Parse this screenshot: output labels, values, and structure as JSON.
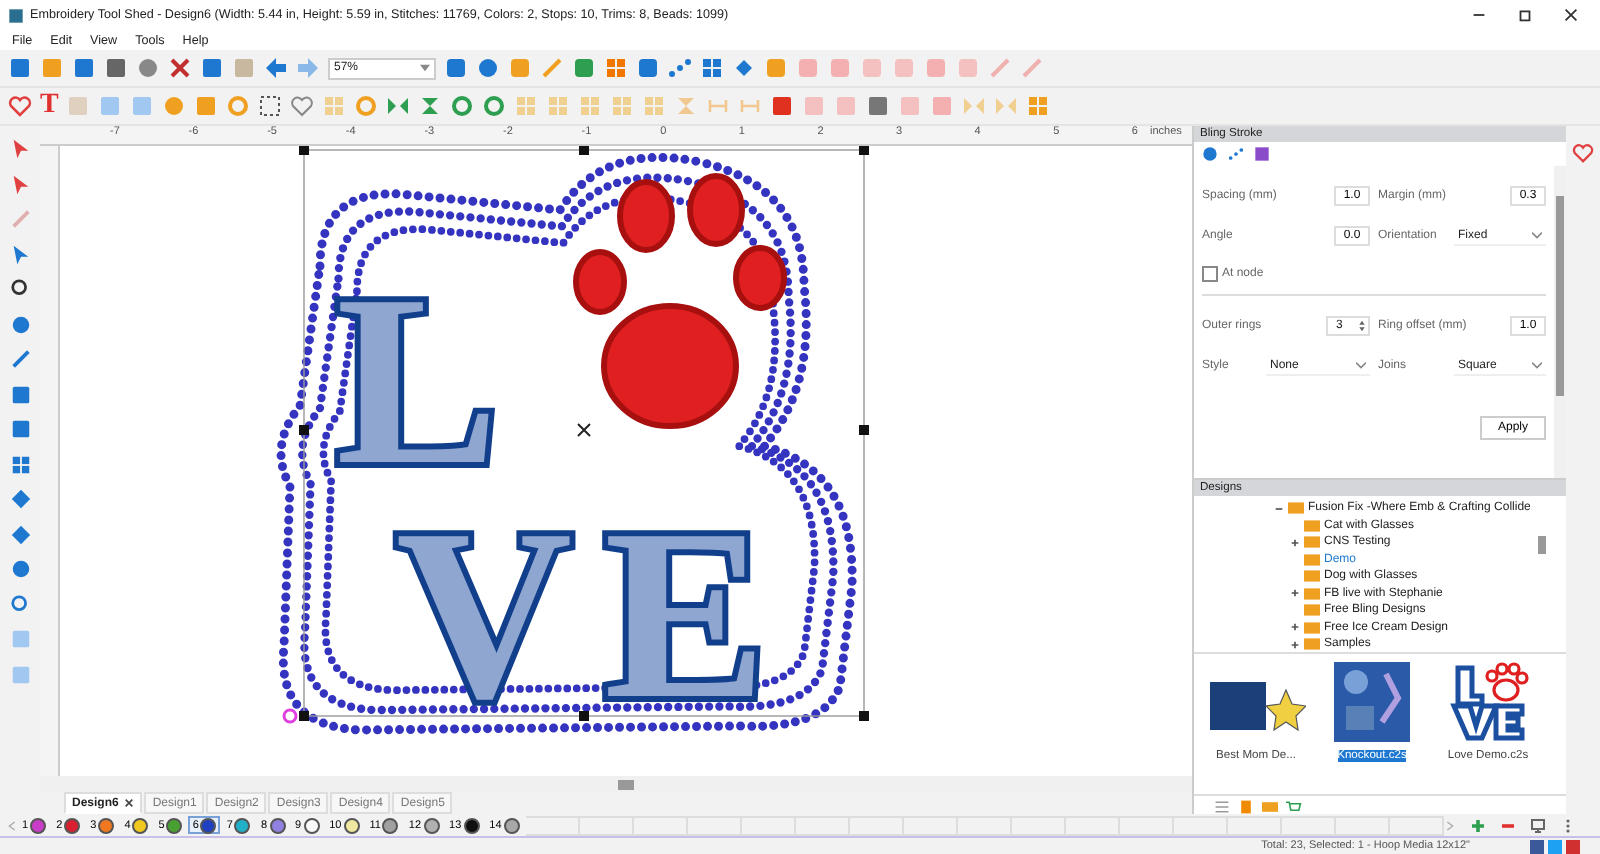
{
  "window": {
    "title": "Embroidery Tool Shed - Design6 (Width: 5.44 in, Height: 5.59 in, Stitches: 11769, Colors: 2, Stops: 10, Trims: 8, Beads: 1099)"
  },
  "menu": [
    "File",
    "Edit",
    "View",
    "Tools",
    "Help"
  ],
  "toolbar": {
    "zoom": "57%",
    "text_tool": "T"
  },
  "ruler": {
    "labels": [
      "-7",
      "-6",
      "-5",
      "-4",
      "-3",
      "-2",
      "-1",
      "0",
      "1",
      "2",
      "3",
      "4",
      "5",
      "6"
    ],
    "unit": "inches"
  },
  "canvas": {
    "letters": [
      "L",
      "V",
      "E"
    ]
  },
  "bling_panel": {
    "title": "Bling Stroke",
    "rows": [
      {
        "kind": "pair",
        "left": {
          "label": "Spacing (mm)",
          "value": "1.0",
          "kind": "input"
        },
        "right": {
          "label": "Margin (mm)",
          "value": "0.3",
          "kind": "input"
        }
      },
      {
        "kind": "pair",
        "left": {
          "label": "Angle",
          "value": "0.0",
          "kind": "input"
        },
        "right": {
          "label": "Orientation",
          "value": "Fixed",
          "kind": "dropdown"
        }
      },
      {
        "kind": "check",
        "label": "At node",
        "checked": false
      },
      {
        "kind": "pair",
        "left": {
          "label": "Outer rings",
          "value": "3",
          "kind": "spinner"
        },
        "right": {
          "label": "Ring offset (mm)",
          "value": "1.0",
          "kind": "input"
        }
      },
      {
        "kind": "pair",
        "left": {
          "label": "Style",
          "value": "None",
          "kind": "dropdown"
        },
        "right": {
          "label": "Joins",
          "value": "Square",
          "kind": "dropdown"
        }
      }
    ],
    "apply": "Apply"
  },
  "designs_panel": {
    "title": "Designs",
    "tree": [
      {
        "label": "Fusion Fix -Where Emb & Crafting Collide",
        "expanded": true,
        "selected": false,
        "children": [
          {
            "label": "Cat with Glasses",
            "selected": false
          },
          {
            "label": "CNS Testing",
            "expanded": false,
            "selected": false
          },
          {
            "label": "Demo",
            "selected": true
          },
          {
            "label": "Dog with Glasses",
            "selected": false
          },
          {
            "label": "FB live with Stephanie",
            "expanded": false,
            "selected": false
          },
          {
            "label": "Free Bling Designs",
            "selected": false
          },
          {
            "label": "Free Ice Cream Design",
            "expanded": false,
            "selected": false
          },
          {
            "label": "Samples",
            "expanded": false,
            "selected": false
          }
        ]
      }
    ],
    "thumbnails": [
      {
        "label": "Best Mom De...",
        "kind": "mom",
        "selected": false
      },
      {
        "label": "Knockout.c2s",
        "kind": "knockout",
        "selected": true
      },
      {
        "label": "Love Demo.c2s",
        "kind": "love",
        "selected": false
      }
    ]
  },
  "design_tabs": [
    {
      "label": "Design6",
      "selected": true
    },
    {
      "label": "Design1",
      "selected": false
    },
    {
      "label": "Design2",
      "selected": false
    },
    {
      "label": "Design3",
      "selected": false
    },
    {
      "label": "Design4",
      "selected": false
    },
    {
      "label": "Design5",
      "selected": false
    }
  ],
  "palette": [
    {
      "number": "1",
      "color": "#c83cc8",
      "selected": false
    },
    {
      "number": "2",
      "color": "#d82030",
      "selected": false
    },
    {
      "number": "3",
      "color": "#f07820",
      "selected": false
    },
    {
      "number": "4",
      "color": "#f0c820",
      "selected": false
    },
    {
      "number": "5",
      "color": "#48a030",
      "selected": false
    },
    {
      "number": "6",
      "color": "#2040c0",
      "selected": true
    },
    {
      "number": "7",
      "color": "#20b0c8",
      "selected": false
    },
    {
      "number": "8",
      "color": "#9080e0",
      "selected": false
    },
    {
      "number": "9",
      "color": "#f8f8f8",
      "selected": false
    },
    {
      "number": "10",
      "color": "#f0e8a0",
      "selected": false
    },
    {
      "number": "11",
      "color": "#a0a0a0",
      "selected": false
    },
    {
      "number": "12",
      "color": "#b0b0b0",
      "selected": false
    },
    {
      "number": "13",
      "color": "#101010",
      "selected": false
    },
    {
      "number": "14",
      "color": "#a8a8a8",
      "selected": false
    }
  ],
  "status_bar": {
    "text": "Total: 23, Selected: 1 - Hoop Media 12x12\""
  }
}
